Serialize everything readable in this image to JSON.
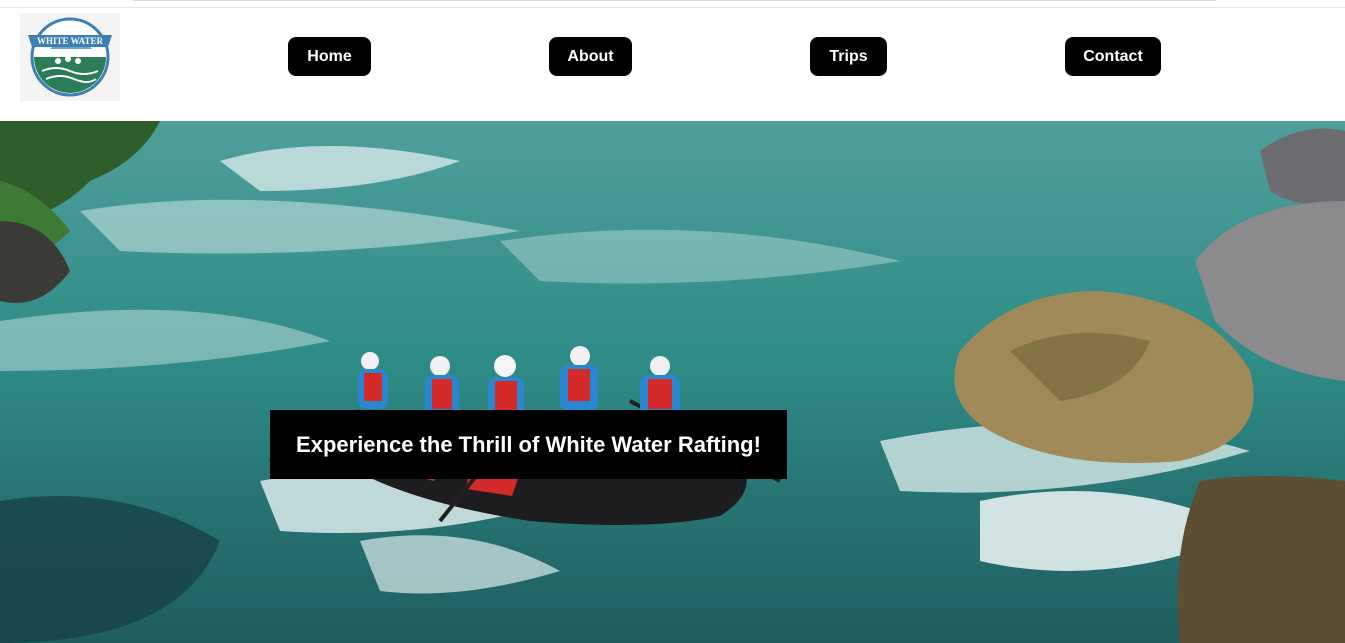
{
  "logo": {
    "text": "WHITE WATER"
  },
  "nav": {
    "home": "Home",
    "about": "About",
    "trips": "Trips",
    "contact": "Contact"
  },
  "hero": {
    "title": "Experience the Thrill of White Water Rafting!"
  },
  "colors": {
    "button_bg": "#000000",
    "button_text": "#ffffff",
    "water": "#2f8f8a",
    "logo_green": "#2a7d58",
    "logo_blue": "#3c7fb5"
  }
}
